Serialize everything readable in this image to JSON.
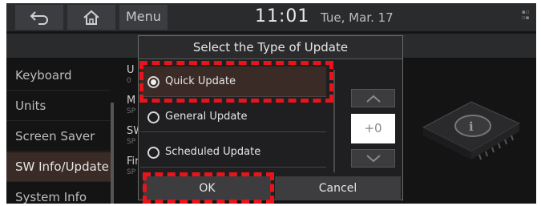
{
  "statusbar": {
    "menu_label": "Menu",
    "time": "11:01",
    "date": "Tue, Mar. 17",
    "back_icon": "back-arrow-icon",
    "home_icon": "home-icon"
  },
  "sidebar": {
    "items": [
      {
        "label": "Keyboard"
      },
      {
        "label": "Units"
      },
      {
        "label": "Screen Saver"
      },
      {
        "label": "SW Info/Update",
        "active": true
      },
      {
        "label": "System Info"
      }
    ]
  },
  "content_peek": [
    {
      "title": "U",
      "sub": "0"
    },
    {
      "title": "M",
      "sub": "SP"
    },
    {
      "title": "SW",
      "sub": "SP"
    },
    {
      "title": "Fir",
      "sub": "SP"
    }
  ],
  "dialog": {
    "title": "Select the Type of Update",
    "options": [
      {
        "label": "Quick Update",
        "selected": true
      },
      {
        "label": "General Update",
        "selected": false
      },
      {
        "label": "Scheduled Update",
        "selected": false
      }
    ],
    "stepper_value": "+0",
    "ok_label": "OK",
    "cancel_label": "Cancel"
  },
  "colors": {
    "highlight": "#e8141a",
    "selected_bg": "#3b2b26"
  }
}
